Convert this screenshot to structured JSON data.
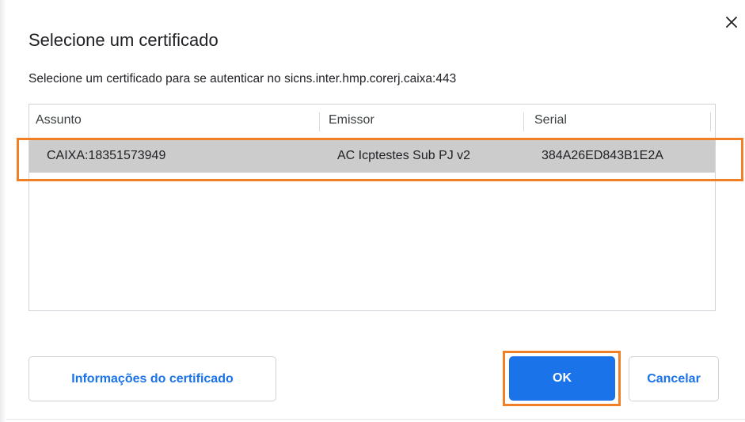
{
  "dialog": {
    "title": "Selecione um certificado",
    "subtitle": "Selecione um certificado para se autenticar no sicns.inter.hmp.corerj.caixa:443",
    "close_glyph": "✕"
  },
  "table": {
    "columns": [
      "Assunto",
      "Emissor",
      "Serial"
    ],
    "rows": [
      {
        "subject": "CAIXA:18351573949",
        "issuer": "AC Icptestes Sub PJ v2",
        "serial": "384A26ED843B1E2A"
      }
    ]
  },
  "buttons": {
    "info_label": "Informações do certificado",
    "ok_label": "OK",
    "cancel_label": "Cancelar"
  },
  "colors": {
    "accent": "#1a73e8",
    "highlight": "#f07f26",
    "selected_row": "#cccccc"
  },
  "icons": {
    "close": "close-icon"
  }
}
